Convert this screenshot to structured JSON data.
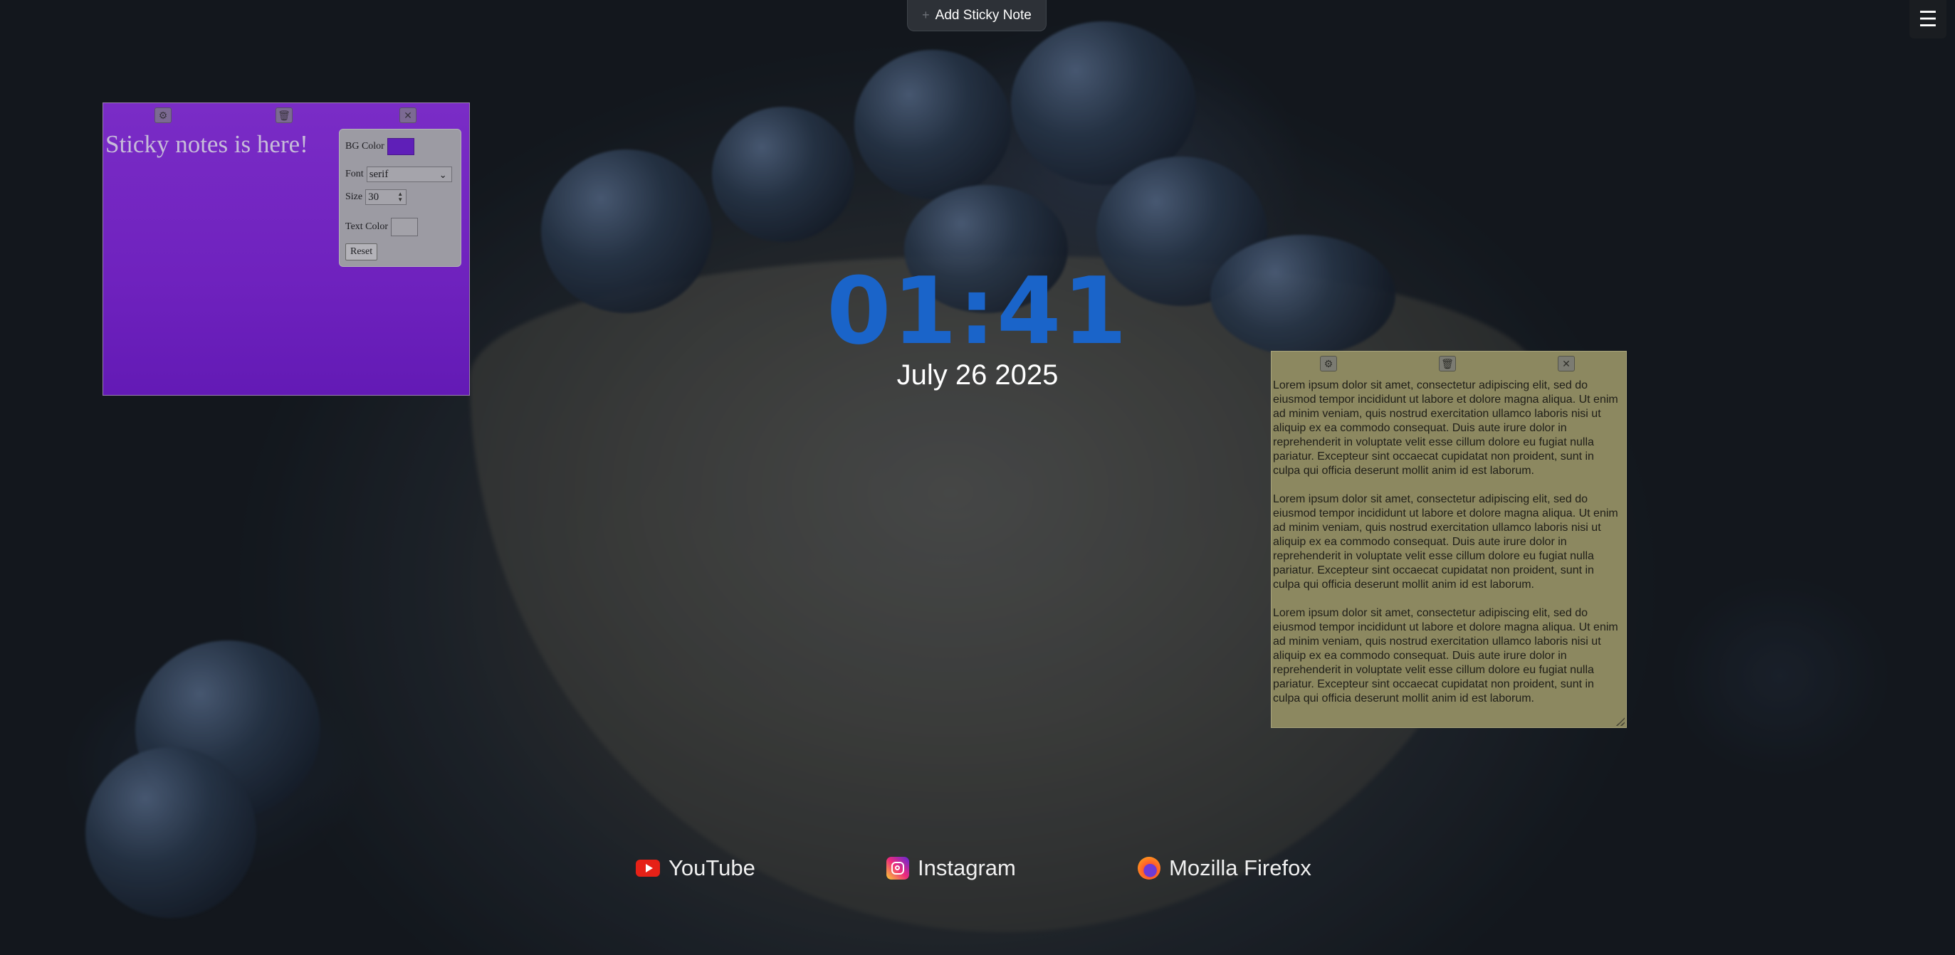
{
  "toolbar": {
    "add_note_label": "Add Sticky Note",
    "add_note_icon": "plus-icon",
    "menu_icon": "☰"
  },
  "clock": {
    "time": "01:41",
    "date": "July 26 2025",
    "color": "#1a64c9"
  },
  "notes": [
    {
      "text": "Sticky notes is here!",
      "bg_color": "#6f22be",
      "toolbar_icons": {
        "settings": "⚙",
        "delete": "🗑",
        "close": "✕"
      },
      "settings": {
        "bg_color_label": "BG Color",
        "font_label": "Font",
        "font_value": "serif",
        "size_label": "Size",
        "size_value": "30",
        "text_color_label": "Text Color",
        "reset_label": "Reset"
      }
    },
    {
      "bg_color": "#8c8860",
      "toolbar_icons": {
        "settings": "⚙",
        "delete": "🗑",
        "close": "✕"
      },
      "paragraphs": [
        "Lorem ipsum dolor sit amet, consectetur adipiscing elit, sed do eiusmod tempor incididunt ut labore et dolore magna aliqua. Ut enim ad minim veniam, quis nostrud exercitation ullamco laboris nisi ut aliquip ex ea commodo consequat. Duis aute irure dolor in reprehenderit in voluptate velit esse cillum dolore eu fugiat nulla pariatur. Excepteur sint occaecat cupidatat non proident, sunt in culpa qui officia deserunt mollit anim id est laborum.",
        "Lorem ipsum dolor sit amet, consectetur adipiscing elit, sed do eiusmod tempor incididunt ut labore et dolore magna aliqua. Ut enim ad minim veniam, quis nostrud exercitation ullamco laboris nisi ut aliquip ex ea commodo consequat. Duis aute irure dolor in reprehenderit in voluptate velit esse cillum dolore eu fugiat nulla pariatur. Excepteur sint occaecat cupidatat non proident, sunt in culpa qui officia deserunt mollit anim id est laborum.",
        "Lorem ipsum dolor sit amet, consectetur adipiscing elit, sed do eiusmod tempor incididunt ut labore et dolore magna aliqua. Ut enim ad minim veniam, quis nostrud exercitation ullamco laboris nisi ut aliquip ex ea commodo consequat. Duis aute irure dolor in reprehenderit in voluptate velit esse cillum dolore eu fugiat nulla pariatur. Excepteur sint occaecat cupidatat non proident, sunt in culpa qui officia deserunt mollit anim id est laborum."
      ]
    }
  ],
  "shortcuts": [
    {
      "label": "YouTube",
      "icon": "youtube-icon"
    },
    {
      "label": "Instagram",
      "icon": "instagram-icon"
    },
    {
      "label": "Mozilla Firefox",
      "icon": "firefox-icon"
    }
  ]
}
